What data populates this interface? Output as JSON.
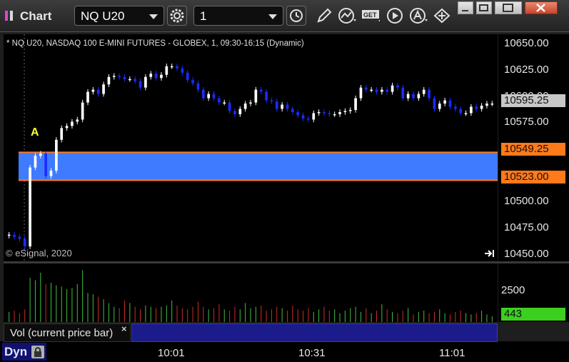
{
  "window": {
    "app_title": "Chart",
    "symbol_value": "NQ U20",
    "interval_value": "1",
    "icons": [
      "settings-gear-icon",
      "clock-icon",
      "pencil-icon",
      "line-study-icon",
      "get-data-icon",
      "play-icon",
      "alert-icon",
      "move-arrows-icon"
    ],
    "window_buttons": [
      "minimize-icon",
      "restore-icon",
      "maximize-icon",
      "close-icon"
    ]
  },
  "chart": {
    "info_line": "* NQ U20, NASDAQ 100 E-MINI FUTURES - GLOBEX, 1, 09:30-16:15 (Dynamic)",
    "credit": "© eSignal, 2020",
    "marker_label": "A",
    "price_ticks": [
      "10650.00",
      "10625.00",
      "10600.00",
      "10575.00",
      "10549.25",
      "10523.00",
      "10500.00",
      "10475.00",
      "10450.00"
    ],
    "last_price": "10595.25",
    "upper_level": "10549.25",
    "lower_level": "10523.00",
    "time_ticks": [
      "10:01",
      "10:31",
      "11:01"
    ],
    "volume_label": "Vol (current price bar)",
    "volume_ticks": [
      "2500"
    ],
    "volume_zero": "0",
    "volume_last": "443",
    "dyn_label": "Dyn"
  },
  "colors": {
    "zone": "#3f7bff",
    "level_line": "#ff7a1a",
    "up_candle": "#ffffff",
    "down_candle": "#1a2cff",
    "vol_up": "#3fbf3f",
    "vol_down": "#d02a2a",
    "last_price_box": "#c8c8c8",
    "vol_last_box": "#3ccf20"
  },
  "chart_data": {
    "type": "candlestick",
    "ylim": [
      10447,
      10660
    ],
    "zone": [
      10523.0,
      10549.25
    ],
    "closes": [
      10472,
      10470,
      10468,
      10461,
      10535,
      10546,
      10548,
      10527,
      10532,
      10561,
      10572,
      10574,
      10578,
      10580,
      10596,
      10606,
      10608,
      10604,
      10613,
      10620,
      10621,
      10620,
      10618,
      10618,
      10616,
      10610,
      10620,
      10623,
      10619,
      10622,
      10630,
      10630,
      10628,
      10624,
      10617,
      10614,
      10608,
      10600,
      10604,
      10600,
      10596,
      10596,
      10588,
      10585,
      10590,
      10595,
      10596,
      10608,
      10606,
      10598,
      10597,
      10590,
      10594,
      10590,
      10587,
      10584,
      10581,
      10580,
      10586,
      10587,
      10586,
      10585,
      10585,
      10587,
      10588,
      10589,
      10600,
      10610,
      10608,
      10608,
      10606,
      10608,
      10606,
      10612,
      10610,
      10600,
      10604,
      10600,
      10604,
      10608,
      10600,
      10590,
      10595,
      10598,
      10592,
      10590,
      10586,
      10586,
      10592,
      10590,
      10593,
      10595,
      10595
    ],
    "volume": [
      800,
      900,
      700,
      1000,
      3500,
      3300,
      3900,
      3000,
      3100,
      2900,
      2800,
      2600,
      2700,
      3000,
      4100,
      2300,
      2200,
      2000,
      1800,
      1500,
      1200,
      1100,
      1700,
      1500,
      1200,
      1000,
      1300,
      1200,
      1100,
      1200,
      1300,
      1700,
      1300,
      1100,
      1000,
      1200,
      1600,
      1200,
      1000,
      1100,
      1400,
      1000,
      900,
      1200,
      1000,
      1500,
      1100,
      1200,
      1300,
      900,
      1000,
      1200,
      1100,
      900,
      1300,
      1000,
      900,
      1100,
      800,
      1000,
      1200,
      900,
      1000,
      700,
      900,
      1100,
      1200,
      800,
      1100,
      700,
      900,
      1400,
      1000,
      800,
      700,
      900,
      1100,
      600,
      800,
      900,
      700,
      800,
      1000,
      700,
      600,
      800,
      900,
      700,
      600,
      700,
      900,
      600,
      443
    ],
    "volume_ylim": [
      0,
      4400
    ]
  }
}
